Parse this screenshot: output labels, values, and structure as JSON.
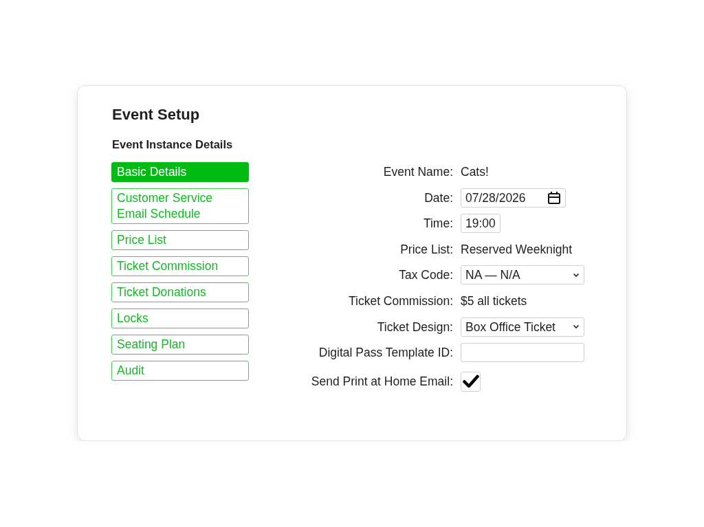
{
  "window": {
    "title": "Event Setup"
  },
  "section": {
    "title": "Event Instance Details"
  },
  "sidebar": {
    "items": [
      {
        "label": "Basic Details",
        "selected": true
      },
      {
        "label": "Customer Service Email Schedule",
        "selected": false
      },
      {
        "label": "Price List",
        "selected": false
      },
      {
        "label": "Ticket Commission",
        "selected": false
      },
      {
        "label": "Ticket Donations",
        "selected": false
      },
      {
        "label": "Locks",
        "selected": false
      },
      {
        "label": "Seating Plan",
        "selected": false
      },
      {
        "label": "Audit",
        "selected": false
      }
    ]
  },
  "fields": [
    {
      "kind": "text",
      "label": "Event Name:",
      "value": "Cats!"
    },
    {
      "kind": "date",
      "label": "Date:",
      "value": "07/28/2026"
    },
    {
      "kind": "time",
      "label": "Time:",
      "value": "19:00"
    },
    {
      "kind": "text",
      "label": "Price List:",
      "value": "Reserved Weeknight"
    },
    {
      "kind": "select",
      "label": "Tax Code:",
      "value": "NA — N/A"
    },
    {
      "kind": "text",
      "label": "Ticket Commission:",
      "value": "$5 all tickets"
    },
    {
      "kind": "select",
      "label": "Ticket Design:",
      "value": "Box Office Ticket"
    },
    {
      "kind": "input",
      "label": "Digital Pass Template ID:"
    },
    {
      "kind": "checkbox",
      "label": "Send Print at Home Email:",
      "checked": true
    }
  ]
}
